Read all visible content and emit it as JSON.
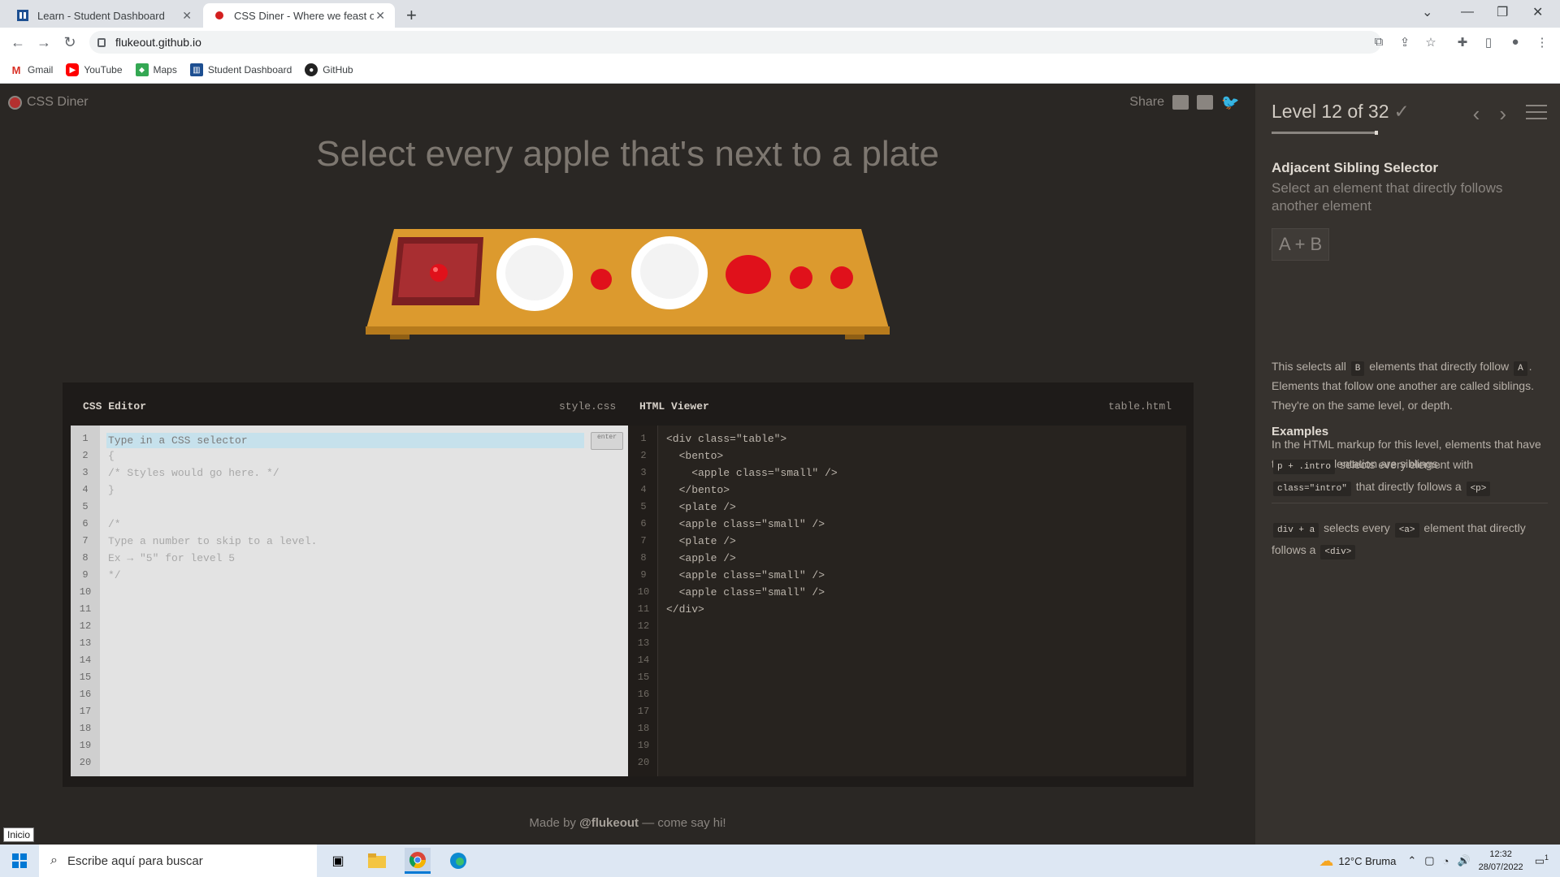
{
  "browser": {
    "tabs": [
      {
        "title": "Learn - Student Dashboard",
        "active": false
      },
      {
        "title": "CSS Diner - Where we feast on CSS",
        "active": true
      }
    ],
    "url": "flukeout.github.io",
    "bookmarks": [
      "Gmail",
      "YouTube",
      "Maps",
      "Student Dashboard",
      "GitHub"
    ]
  },
  "game": {
    "logo": "CSS Diner",
    "share_label": "Share",
    "instruction": "Select every apple that's next to a plate",
    "css_editor": {
      "title": "CSS Editor",
      "filename": "style.css",
      "placeholder": "Type in a CSS selector",
      "enter_label": "enter",
      "lines": [
        "",
        "{",
        "/* Styles would go here. */",
        "}",
        "",
        "/*",
        "Type a number to skip to a level.",
        "Ex → \"5\" for level 5",
        "*/"
      ]
    },
    "html_viewer": {
      "title": "HTML Viewer",
      "filename": "table.html",
      "lines": [
        "<div class=\"table\">",
        "  <bento>",
        "    <apple class=\"small\" />",
        "  </bento>",
        "  <plate />",
        "  <apple class=\"small\" />",
        "  <plate />",
        "  <apple />",
        "  <apple class=\"small\" />",
        "  <apple class=\"small\" />",
        "</div>"
      ]
    },
    "line_numbers": [
      "1",
      "2",
      "3",
      "4",
      "5",
      "6",
      "7",
      "8",
      "9",
      "10",
      "11",
      "12",
      "13",
      "14",
      "15",
      "16",
      "17",
      "18",
      "19",
      "20"
    ],
    "footer": {
      "prefix": "Made by",
      "author": "@flukeout",
      "suffix": "— come say hi!"
    }
  },
  "sidebar": {
    "level": "Level 12 of 32",
    "check": "✓",
    "selector_name": "Adjacent Sibling Selector",
    "selector_title": "Select an element that directly follows another element",
    "syntax": "A + B",
    "hint1": {
      "p1": "This selects all",
      "b": "B",
      "p2": "elements that directly follow",
      "a": "A",
      "p3": ". Elements that follow one another are called siblings. They're on the same level, or depth."
    },
    "hint2": "In the HTML markup for this level, elements that have the same indentation are siblings.",
    "examples_title": "Examples",
    "examples": [
      {
        "code": "p + .intro",
        "t1": "selects every element with",
        "code2": "class=\"intro\"",
        "t2": "that directly follows a",
        "code3": "<p>"
      },
      {
        "code": "div + a",
        "t1": "selects every",
        "code2": "<a>",
        "t2": "element that directly follows a",
        "code3": "<div>"
      }
    ]
  },
  "taskbar": {
    "search_placeholder": "Escribe aquí para buscar",
    "weather": "12°C  Bruma",
    "time": "12:32",
    "date": "28/07/2022",
    "notifications": "1",
    "tooltip": "Inicio"
  },
  "colors": {
    "bg": "#2a2724",
    "sidebar": "#36322e",
    "table": "#e0a030",
    "apple": "#e0111b",
    "bento": "#9b2b2d"
  }
}
